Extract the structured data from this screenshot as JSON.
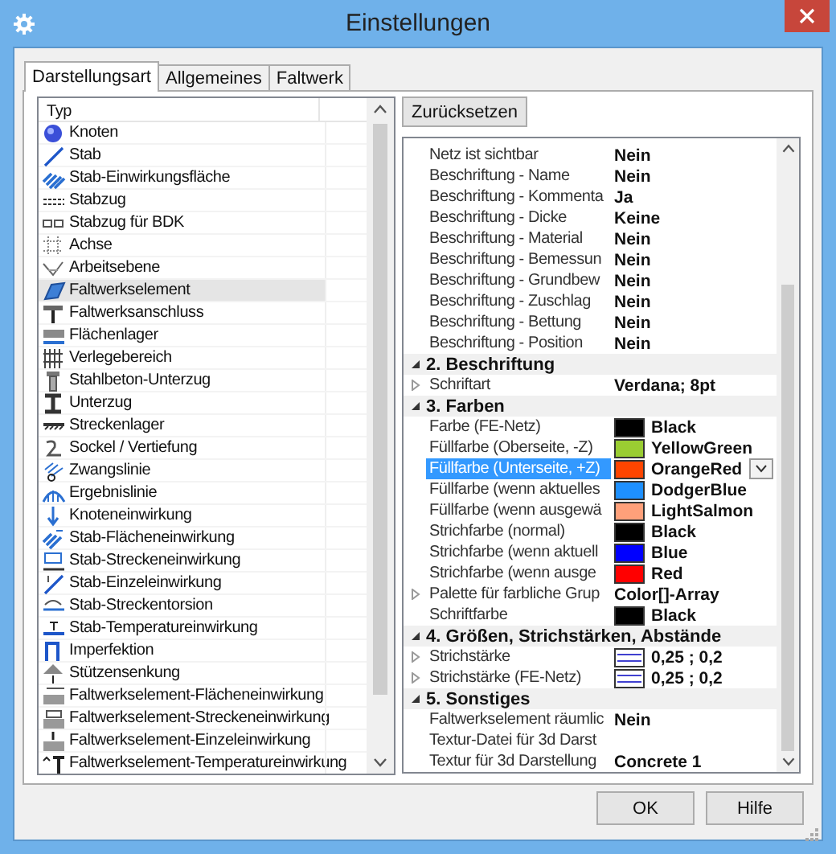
{
  "window": {
    "title": "Einstellungen"
  },
  "tabs": [
    {
      "label": "Darstellungsart",
      "selected": true
    },
    {
      "label": "Allgemeines",
      "selected": false
    },
    {
      "label": "Faltwerk",
      "selected": false
    }
  ],
  "type_list": {
    "column": "Typ",
    "items": [
      {
        "label": "Knoten",
        "selected": false
      },
      {
        "label": "Stab",
        "selected": false
      },
      {
        "label": "Stab-Einwirkungsfläche",
        "selected": false
      },
      {
        "label": "Stabzug",
        "selected": false
      },
      {
        "label": "Stabzug für BDK",
        "selected": false
      },
      {
        "label": "Achse",
        "selected": false
      },
      {
        "label": "Arbeitsebene",
        "selected": false
      },
      {
        "label": "Faltwerkselement",
        "selected": true
      },
      {
        "label": "Faltwerksanschluss",
        "selected": false
      },
      {
        "label": "Flächenlager",
        "selected": false
      },
      {
        "label": "Verlegebereich",
        "selected": false
      },
      {
        "label": "Stahlbeton-Unterzug",
        "selected": false
      },
      {
        "label": "Unterzug",
        "selected": false
      },
      {
        "label": "Streckenlager",
        "selected": false
      },
      {
        "label": "Sockel / Vertiefung",
        "selected": false
      },
      {
        "label": "Zwangslinie",
        "selected": false
      },
      {
        "label": "Ergebnislinie",
        "selected": false
      },
      {
        "label": "Knoteneinwirkung",
        "selected": false
      },
      {
        "label": "Stab-Flächeneinwirkung",
        "selected": false
      },
      {
        "label": "Stab-Streckeneinwirkung",
        "selected": false
      },
      {
        "label": "Stab-Einzeleinwirkung",
        "selected": false
      },
      {
        "label": "Stab-Streckentorsion",
        "selected": false
      },
      {
        "label": "Stab-Temperatureinwirkung",
        "selected": false
      },
      {
        "label": "Imperfektion",
        "selected": false
      },
      {
        "label": "Stützensenkung",
        "selected": false
      },
      {
        "label": "Faltwerkselement-Flächeneinwirkung",
        "selected": false
      },
      {
        "label": "Faltwerkselement-Streckeneinwirkung",
        "selected": false
      },
      {
        "label": "Faltwerkselement-Einzeleinwirkung",
        "selected": false
      },
      {
        "label": "Faltwerkselement-Temperatureinwirkung",
        "selected": false
      }
    ]
  },
  "reset_button": "Zurücksetzen",
  "properties": [
    {
      "kind": "property",
      "name": "Netz ist sichtbar",
      "value": "Nein",
      "selected": false
    },
    {
      "kind": "property",
      "name": "Beschriftung - Name",
      "value": "Nein",
      "selected": false
    },
    {
      "kind": "property",
      "name": "Beschriftung - Kommenta",
      "value": "Ja",
      "selected": false
    },
    {
      "kind": "property",
      "name": "Beschriftung - Dicke",
      "value": "Keine",
      "selected": false
    },
    {
      "kind": "property",
      "name": "Beschriftung - Material",
      "value": "Nein",
      "selected": false
    },
    {
      "kind": "property",
      "name": "Beschriftung - Bemessun",
      "value": "Nein",
      "selected": false
    },
    {
      "kind": "property",
      "name": "Beschriftung - Grundbew",
      "value": "Nein",
      "selected": false
    },
    {
      "kind": "property",
      "name": "Beschriftung - Zuschlag",
      "value": "Nein",
      "selected": false
    },
    {
      "kind": "property",
      "name": "Beschriftung - Bettung",
      "value": "Nein",
      "selected": false
    },
    {
      "kind": "property",
      "name": "Beschriftung - Position",
      "value": "Nein",
      "selected": false
    },
    {
      "kind": "category",
      "name": "2. Beschriftung",
      "expanded": true,
      "selected": false
    },
    {
      "kind": "property",
      "name": "Schriftart",
      "value": "Verdana; 8pt",
      "expanded": false,
      "selected": false
    },
    {
      "kind": "category",
      "name": "3. Farben",
      "expanded": true,
      "selected": false
    },
    {
      "kind": "color",
      "name": "Farbe (FE-Netz)",
      "value": "Black",
      "color": "#000000",
      "selected": false
    },
    {
      "kind": "color",
      "name": "Füllfarbe (Oberseite, -Z)",
      "value": "YellowGreen",
      "color": "#9acd32",
      "selected": false
    },
    {
      "kind": "color",
      "name": "Füllfarbe (Unterseite, +Z)",
      "value": "OrangeRed",
      "color": "#ff4500",
      "selected": true
    },
    {
      "kind": "color",
      "name": "Füllfarbe (wenn aktuelles",
      "value": "DodgerBlue",
      "color": "#1e90ff",
      "selected": false
    },
    {
      "kind": "color",
      "name": "Füllfarbe (wenn ausgewä",
      "value": "LightSalmon",
      "color": "#ffa07a",
      "selected": false
    },
    {
      "kind": "color",
      "name": "Strichfarbe (normal)",
      "value": "Black",
      "color": "#000000",
      "selected": false
    },
    {
      "kind": "color",
      "name": "Strichfarbe (wenn aktuell",
      "value": "Blue",
      "color": "#0000ff",
      "selected": false
    },
    {
      "kind": "color",
      "name": "Strichfarbe (wenn ausge",
      "value": "Red",
      "color": "#ff0000",
      "selected": false
    },
    {
      "kind": "property",
      "name": "Palette für farbliche Grup",
      "value": "Color[]-Array",
      "expanded": false,
      "selected": false
    },
    {
      "kind": "color",
      "name": "Schriftfarbe",
      "value": "Black",
      "color": "#000000",
      "selected": false
    },
    {
      "kind": "category",
      "name": "4. Größen, Strichstärken, Abstände",
      "expanded": true,
      "selected": false
    },
    {
      "kind": "line",
      "name": "Strichstärke",
      "value": "0,25 ; 0,2",
      "expanded": false,
      "selected": false
    },
    {
      "kind": "line",
      "name": "Strichstärke (FE-Netz)",
      "value": "0,25 ; 0,2",
      "expanded": false,
      "selected": false
    },
    {
      "kind": "category",
      "name": "5. Sonstiges",
      "expanded": true,
      "selected": false
    },
    {
      "kind": "property",
      "name": "Faltwerkselement räumlic",
      "value": "Nein",
      "selected": false
    },
    {
      "kind": "property",
      "name": "Textur-Datei für 3d Darst",
      "selected": false
    },
    {
      "kind": "property",
      "name": "Textur für 3d Darstellung",
      "value": "Concrete 1",
      "selected": false
    }
  ],
  "buttons": [
    "OK",
    "Hilfe"
  ]
}
